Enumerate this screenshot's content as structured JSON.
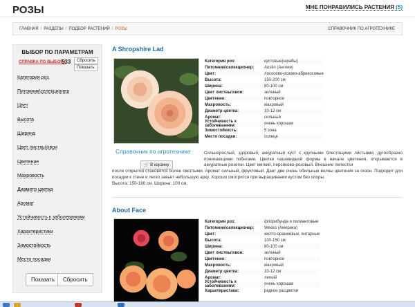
{
  "header": {
    "title": "РОЗЫ",
    "liked_label": "МНЕ ПОНРАВИЛИСЬ РАСТЕНИЯ",
    "liked_count": "(5)"
  },
  "breadcrumb": {
    "items": [
      "ГЛАВНАЯ",
      "РАЗДЕЛЫ",
      "ПОДБОР РАСТЕНИЙ",
      "РОЗЫ"
    ],
    "right_link": "СПРАВОЧНИК ПО АГРОТЕХНИКЕ"
  },
  "sidebar": {
    "heading": "ВЫБОР ПО ПАРАМЕТРАМ",
    "help_link": "СПРАВКА ПО ВЫБОРУ",
    "count": "533",
    "reset_small": "Сбросить",
    "show_small": "Показать",
    "filters": [
      "Категория роз",
      "Питомник\\селекционер",
      "Цвет",
      "Высота",
      "Ширина",
      "Цвет листвы\\хвои",
      "Цветение",
      "Махровость",
      "Диаметр цветка",
      "Аромат",
      "Устойчивость к заболеваниям",
      "Характеристики",
      "Зимостойкость",
      "Место посадки"
    ],
    "show_button": "Показать",
    "reset_button": "Сбросить"
  },
  "products": [
    {
      "name": "A Shropshire Lad",
      "specs": [
        {
          "k": "Категория роз:",
          "v": "кустовые(шрабы)"
        },
        {
          "k": "Питомник\\селекционер:",
          "v": "Austin (Англия)"
        },
        {
          "k": "Цвет:",
          "v": "лососево-розово-абрикосовые"
        },
        {
          "k": "Высота:",
          "v": "150-200 см"
        },
        {
          "k": "Ширина:",
          "v": "80-100 см"
        },
        {
          "k": "Цвет листвы\\хвои:",
          "v": "зеленый"
        },
        {
          "k": "Цветение:",
          "v": "повторное"
        },
        {
          "k": "Махровость:",
          "v": "махровый"
        },
        {
          "k": "Диаметр цветка:",
          "v": "10-12 см"
        },
        {
          "k": "Аромат:",
          "v": "сильный"
        },
        {
          "k": "Устойчивость к заболеваниям:",
          "v": "очень хорошая"
        },
        {
          "k": "Зимостойкость:",
          "v": "5 зона"
        },
        {
          "k": "Место посадки:",
          "v": "солнце"
        }
      ],
      "ref_link": "Справочник по агротехнике",
      "cart_button": "В корзину",
      "desc_first": "Сильнорослый, здоровый, аккуратный куст с крупными блестящими листьями, дугообразно поникающими побегами. Цветки чашевидной формы в начале цветения, открываются в аккуратные розетки. Цвет мягкий, персиково-розовый. Внешние лепестки",
      "desc_rest": "после открытия становятся более светлыми. Аромат сильный, фруктовый. Дает две очень обильные волны цветения за сезон. Подходит для посадки к стене и легко завьет небольшую арку. Хорошо смотрится при выращивании кустом без опоры.",
      "desc_size": "Высота: 150-180 см. Ширина: 100 см."
    },
    {
      "name": "About Face",
      "specs": [
        {
          "k": "Категория роз:",
          "v": "флорибунда и полиантовые"
        },
        {
          "k": "Питомник\\селекционер:",
          "v": "Weeks (Америка)"
        },
        {
          "k": "Цвет:",
          "v": "желто-оранжевые, янтарные"
        },
        {
          "k": "Высота:",
          "v": "100-150 см"
        },
        {
          "k": "Ширина:",
          "v": "80-100 см"
        },
        {
          "k": "Цвет листвы\\хвои:",
          "v": "зеленый"
        },
        {
          "k": "Цветение:",
          "v": "повторное"
        },
        {
          "k": "Махровость:",
          "v": "махровый"
        },
        {
          "k": "Диаметр цветка:",
          "v": "10-12 см"
        },
        {
          "k": "Аромат:",
          "v": "легкий"
        },
        {
          "k": "Устойчивость к заболеваниям:",
          "v": "очень хорошая"
        },
        {
          "k": "Характеристики:",
          "v": "редкое расцветки"
        }
      ]
    }
  ],
  "colors": {
    "accent_blue": "#1e6aa5",
    "breadcrumb_current": "#d6492c",
    "help_link": "#cc3333"
  }
}
